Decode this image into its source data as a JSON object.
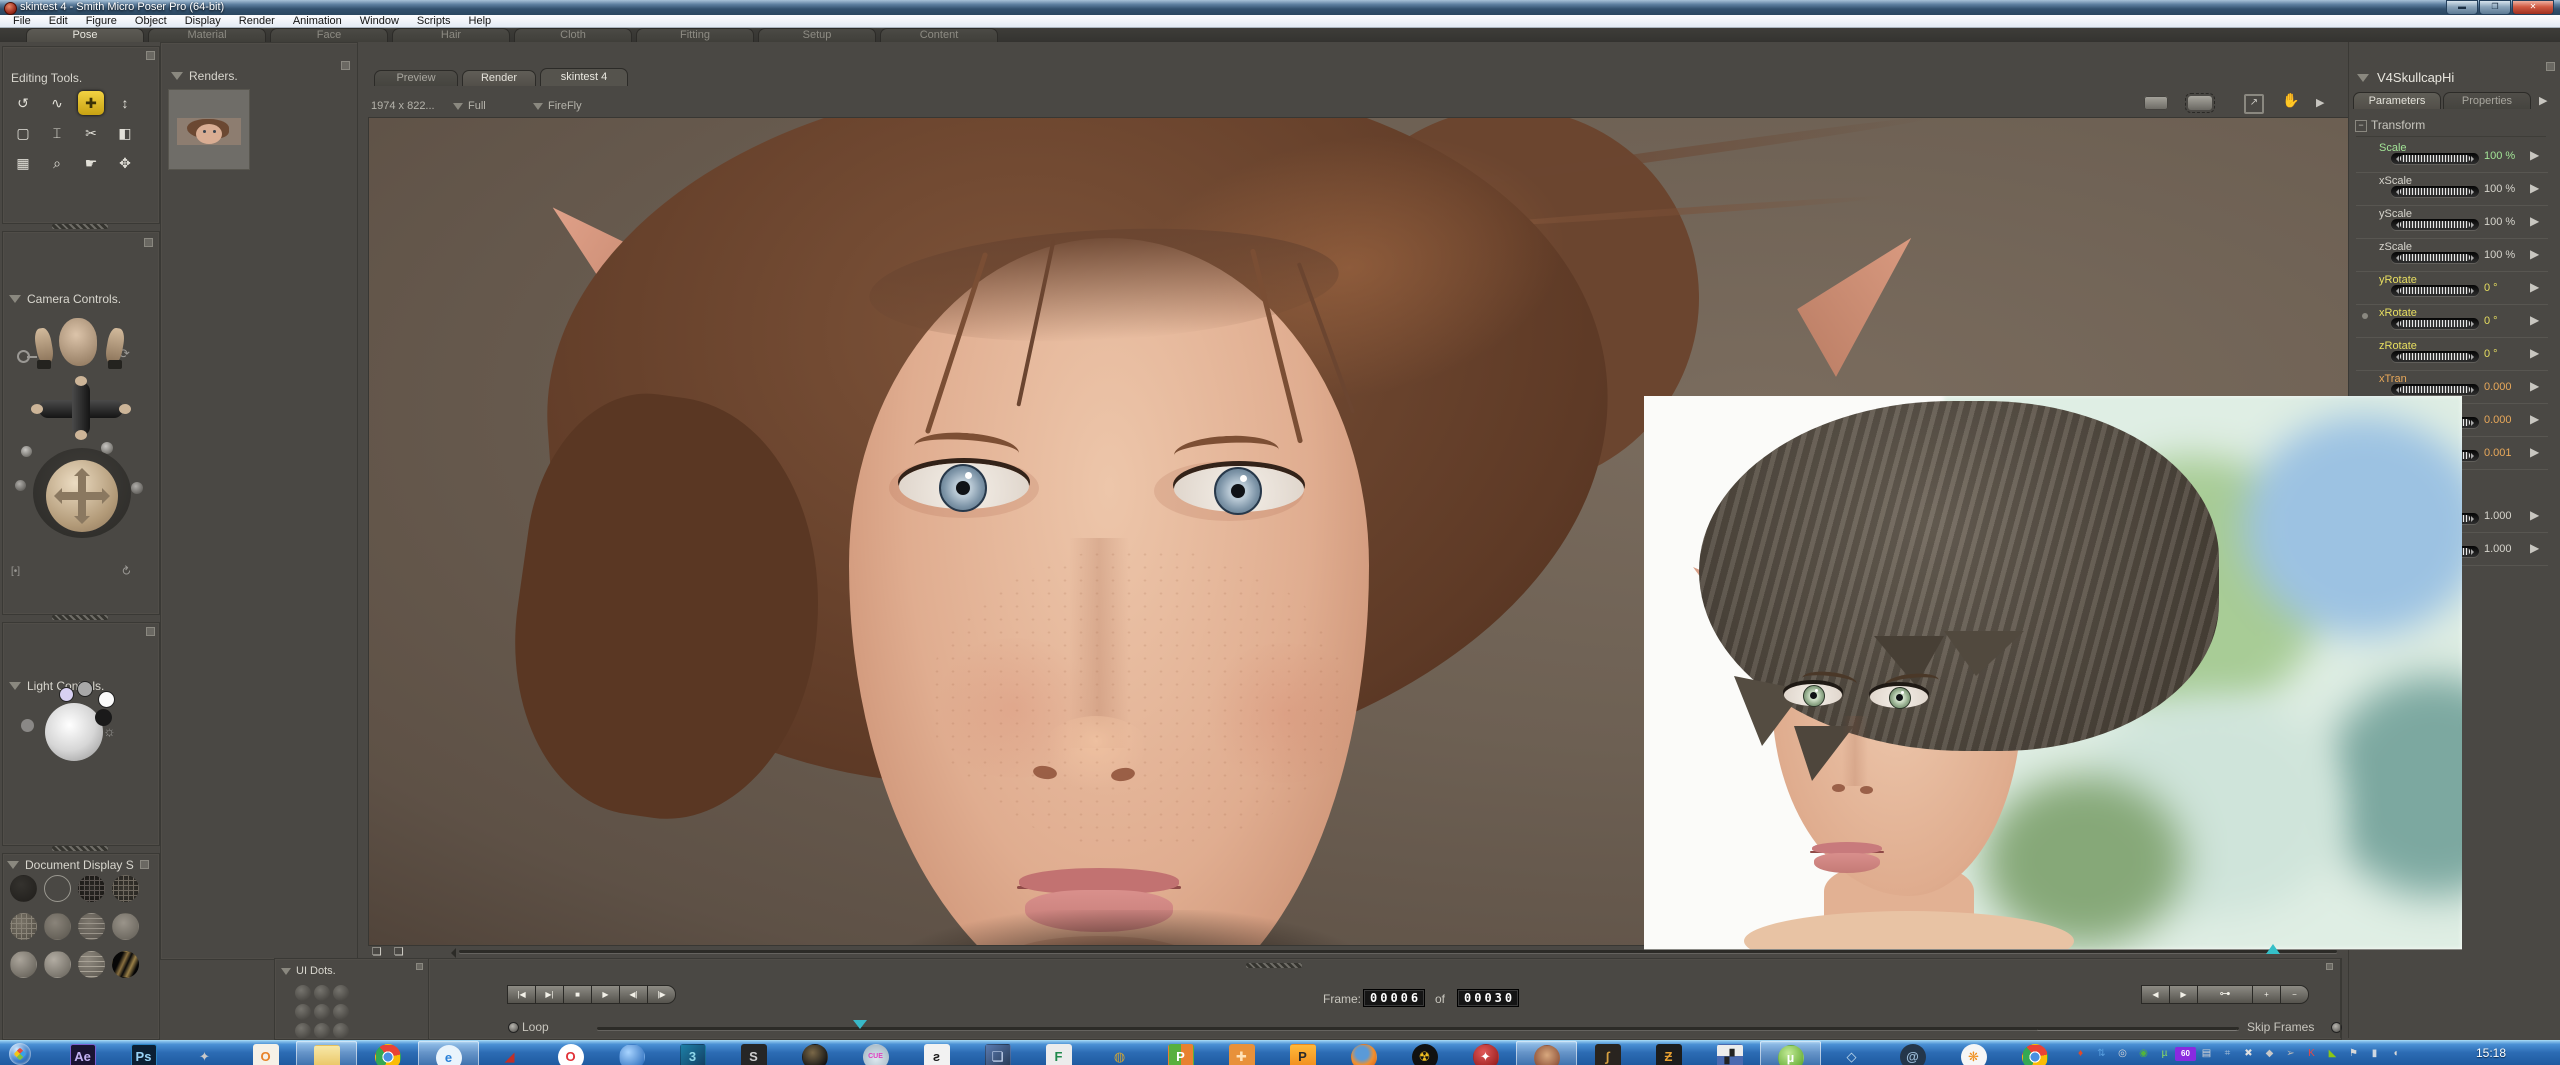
{
  "window": {
    "title": "skintest 4 - Smith Micro Poser Pro  (64-bit)"
  },
  "menu_bar": {
    "items": [
      {
        "label": "File",
        "n": "menu-file"
      },
      {
        "label": "Edit",
        "n": "menu-edit"
      },
      {
        "label": "Figure",
        "n": "menu-figure"
      },
      {
        "label": "Object",
        "n": "menu-object"
      },
      {
        "label": "Display",
        "n": "menu-display"
      },
      {
        "label": "Render",
        "n": "menu-render"
      },
      {
        "label": "Animation",
        "n": "menu-animation"
      },
      {
        "label": "Window",
        "n": "menu-window"
      },
      {
        "label": "Scripts",
        "n": "menu-scripts"
      },
      {
        "label": "Help",
        "n": "menu-help"
      }
    ]
  },
  "room_tabs": [
    {
      "label": "Pose",
      "cls": "active",
      "n": "tab-pose"
    },
    {
      "label": "Material",
      "n": "tab-material"
    },
    {
      "label": "Face",
      "n": "tab-face"
    },
    {
      "label": "Hair",
      "n": "tab-hair"
    },
    {
      "label": "Cloth",
      "n": "tab-cloth"
    },
    {
      "label": "Fitting",
      "n": "tab-fitting"
    },
    {
      "label": "Setup",
      "n": "tab-setup"
    },
    {
      "label": "Content",
      "n": "tab-content"
    }
  ],
  "panels": {
    "editing_tools": {
      "title": "Editing Tools.",
      "tools": [
        {
          "g": "↺",
          "n": "rotate-tool-icon"
        },
        {
          "g": "∿",
          "n": "twist-tool-icon"
        },
        {
          "g": "✚",
          "cls": "sel",
          "n": "translate-pull-tool-icon"
        },
        {
          "g": "↕",
          "n": "translate-inout-tool-icon"
        },
        {
          "g": "▢",
          "n": "scale-tool-icon"
        },
        {
          "g": "⌶",
          "n": "taper-tool-icon"
        },
        {
          "g": "✂",
          "n": "chain-break-tool-icon"
        },
        {
          "g": "◧",
          "n": "color-tool-icon"
        },
        {
          "g": "▦",
          "n": "grouping-tool-icon"
        },
        {
          "g": "⌕",
          "n": "view-magnifier-tool-icon"
        },
        {
          "g": "☛",
          "n": "morphing-tool-icon"
        },
        {
          "g": "✥",
          "n": "direct-manipulation-tool-icon"
        }
      ]
    },
    "camera_controls": {
      "title": "Camera Controls."
    },
    "light_controls": {
      "title": "Light Controls."
    },
    "document_display": {
      "title": "Document Display S",
      "styles": [
        {
          "bg": "radial-gradient(circle at 40% 35%, #34322e, #201e1b)",
          "n": "style-silhouette"
        },
        {
          "bg": "transparent",
          "bd": "#9a9890",
          "n": "style-outline"
        },
        {
          "bg": "repeating-linear-gradient(0deg,#5a5450 0 1px,transparent 1px 5px),repeating-linear-gradient(90deg,#5a5450 0 1px,transparent 1px 5px),radial-gradient(circle,#2a2825,#191714)",
          "n": "style-wireframe"
        },
        {
          "bg": "repeating-linear-gradient(0deg,#6e685e 0 1px,transparent 1px 5px),repeating-linear-gradient(90deg,#6e685e 0 1px,transparent 1px 5px),radial-gradient(circle,#3a3731,#24221e)",
          "n": "style-hidden-line"
        },
        {
          "bg": "repeating-linear-gradient(0deg,#8a8478 0 1px,transparent 1px 5px),repeating-linear-gradient(90deg,#8a8478 0 1px,transparent 1px 5px),radial-gradient(circle at 40% 35%,#7a7468,#4c4840)",
          "n": "style-lit-wireframe"
        },
        {
          "bg": "radial-gradient(circle at 40% 35%,#8a847a,#5a564e)",
          "n": "style-flat-shaded"
        },
        {
          "bg": "repeating-linear-gradient(0deg,#9a948a 0 1px,transparent 1px 5px),radial-gradient(circle at 40% 35%,#7e786e,#54504a)",
          "n": "style-flat-lined"
        },
        {
          "bg": "radial-gradient(circle at 42% 35%,#9a948a,#625e56)",
          "n": "style-cartoon"
        },
        {
          "bg": "radial-gradient(circle at 35% 30%,#aaa49a,#5e5a52)",
          "n": "style-cartoon-lined"
        },
        {
          "bg": "radial-gradient(circle at 35% 30%,#b2aca2,#66625a)",
          "n": "style-smooth-shaded"
        },
        {
          "bg": "repeating-linear-gradient(0deg,#a8a296 0 1px,transparent 1px 5px),radial-gradient(circle at 35% 30%,#8e887e,#5a564e)",
          "n": "style-smooth-lined"
        },
        {
          "bg": "linear-gradient(115deg,#070707 28%,#8a7040 42%,#0a0a0a 54%,#9a8048 68%,#060606 84%)",
          "n": "style-texture-shaded"
        }
      ]
    },
    "renders": {
      "title": "Renders."
    },
    "ui_dots": {
      "title": "UI Dots."
    }
  },
  "render_view": {
    "tabs": [
      {
        "label": "Preview",
        "n": "tab-preview"
      },
      {
        "label": "Render",
        "cls": "active",
        "n": "tab-render"
      },
      {
        "label": "skintest 4",
        "cls": "doc",
        "n": "tab-document-skintest4"
      }
    ],
    "info": {
      "size": "1974 x 822...",
      "zoom": "Full",
      "engine": "FireFly"
    }
  },
  "parameters": {
    "figure": "V4SkullcapHi",
    "tabs": [
      {
        "label": "Parameters",
        "cls": "active",
        "n": "tab-parameters"
      },
      {
        "label": "Properties",
        "n": "tab-properties"
      }
    ],
    "section": "Transform",
    "accent_colors": {
      "scale_green": "#a2e396",
      "neutral": "#d6d4cc",
      "rotate_yellow": "#e8df60",
      "translate_orange": "#e8a85a"
    },
    "dials": [
      {
        "label": "Scale",
        "value": "100 %",
        "c": "#a2e396"
      },
      {
        "label": "xScale",
        "value": "100 %",
        "c": "#d6d4cc"
      },
      {
        "label": "yScale",
        "value": "100 %",
        "c": "#d6d4cc"
      },
      {
        "label": "zScale",
        "value": "100 %",
        "c": "#d6d4cc"
      },
      {
        "label": "yRotate",
        "value": "0 °",
        "c": "#e8df60"
      },
      {
        "label": "xRotate",
        "value": "0 °",
        "c": "#e8df60",
        "dot": "1"
      },
      {
        "label": "zRotate",
        "value": "0 °",
        "c": "#e8df60"
      },
      {
        "label": "xTran",
        "value": "0.000",
        "c": "#e8a85a"
      },
      {
        "label": "",
        "value": "0.000",
        "c": "#e8a85a"
      },
      {
        "label": "",
        "value": "0.001",
        "c": "#e8a85a"
      }
    ],
    "lower_dials": [
      {
        "label": "",
        "value": "1.000",
        "c": "#d6d4cc"
      },
      {
        "label": "",
        "value": "1.000",
        "c": "#d6d4cc"
      }
    ]
  },
  "animation": {
    "transport": [
      {
        "g": "|◀",
        "n": "first-frame-button"
      },
      {
        "g": "▶|",
        "n": "last-frame-button"
      },
      {
        "g": "■",
        "n": "stop-button"
      },
      {
        "g": "▶",
        "n": "play-button"
      },
      {
        "g": "◀|",
        "n": "previous-frame-button"
      },
      {
        "g": "|▶",
        "n": "next-frame-button"
      }
    ],
    "key_transport": [
      {
        "g": "◀",
        "n": "previous-keyframe-button"
      },
      {
        "g": "▶",
        "n": "next-keyframe-button"
      },
      {
        "g": "⊶",
        "cls": "wide",
        "n": "edit-keyframes-button"
      },
      {
        "g": "+",
        "n": "add-keyframe-button"
      },
      {
        "g": "−",
        "n": "delete-keyframe-button"
      }
    ],
    "frame_label": "Frame:",
    "frame_current": "00006",
    "of_label": "of",
    "frame_total": "00030",
    "loop_label": "Loop",
    "skip_frames_label": "Skip Frames"
  },
  "taskbar": {
    "clock": "15:18",
    "pinned": [
      {
        "g": "Ae",
        "bg": "#1a1333",
        "fg": "#c3b2f2",
        "bd": "#7a5fd0",
        "n": "after-effects-icon"
      },
      {
        "g": "Ps",
        "bg": "#0b1f33",
        "fg": "#98d2f5",
        "bd": "#2d84c4",
        "n": "photoshop-icon"
      },
      {
        "g": "✦",
        "bg": "transparent",
        "fg": "#c9c9c9",
        "n": "grey-tool-icon"
      },
      {
        "g": "O",
        "bg": "#f6f1e7",
        "fg": "#e8832a",
        "n": "outlook-icon"
      },
      {
        "g": "",
        "bg": "linear-gradient(180deg,#f7e8a8,#e8c05a)",
        "fg": "#8a6a20",
        "hl": "1",
        "n": "explorer-folder-icon"
      },
      {
        "g": "",
        "bg": "radial-gradient(circle at 50% 50%,#4a90e2 0 26%,#ffffff 27% 33%,transparent 34%),conic-gradient(from -40deg,#ea4335 0 33%,#fbbc05 0 66%,#34a853 0 100%)",
        "cls": "round",
        "n": "chrome-icon"
      },
      {
        "g": "e",
        "bg": "#eaf4fc",
        "fg": "#2a80d8",
        "cls": "round",
        "hl": "1",
        "n": "internet-explorer-icon"
      },
      {
        "g": "◢",
        "bg": "transparent",
        "fg": "#c23028",
        "n": "red-utility-icon"
      },
      {
        "g": "O",
        "bg": "#ffffff",
        "fg": "#e13238",
        "cls": "round",
        "n": "opera-icon"
      },
      {
        "g": "",
        "bg": "radial-gradient(circle at 35% 30%,#a8d4ff,#1c60b4)",
        "cls": "round",
        "n": "blue-orb-icon"
      },
      {
        "g": "3",
        "bg": "linear-gradient(135deg,#1d7fa6,#123a5e)",
        "fg": "#8fd8ea",
        "n": "3ds-max-icon"
      },
      {
        "g": "S",
        "bg": "#262626",
        "fg": "#cfcfcf",
        "n": "dark-s-icon"
      },
      {
        "g": "",
        "bg": "radial-gradient(circle at 40% 32%,#7a6848,#151515 75%)",
        "cls": "round",
        "n": "dark-sphere-icon"
      },
      {
        "g": "CUE",
        "bg": "radial-gradient(circle at 50% 58%,#dce8ee,#9fb2c0)",
        "fg": "#e03ec0",
        "cls": "cue",
        "n": "cue-disc-icon"
      },
      {
        "g": "ƨ",
        "bg": "#f2f2f2",
        "fg": "#1a1a1a",
        "n": "runner-icon"
      },
      {
        "g": "❏",
        "bg": "linear-gradient(135deg,#5a7ab0,#233650)",
        "fg": "#d8e6ff",
        "n": "computer-search-icon"
      },
      {
        "g": "F",
        "bg": "#ececec",
        "fg": "#1f8a4c",
        "n": "fxp-icon"
      },
      {
        "g": "◍",
        "bg": "transparent",
        "fg": "#caa23a",
        "n": "padlock-icon"
      },
      {
        "g": "P",
        "bg": "linear-gradient(90deg,#57b03e 50%,#e8812f 50%)",
        "fg": "#ffffff",
        "n": "peazip-icon"
      },
      {
        "g": "✚",
        "bg": "#e8913a",
        "fg": "#ffe2b8",
        "n": "orange-puzzle-icon"
      },
      {
        "g": "P",
        "bg": "linear-gradient(180deg,#ffb83a,#f08a1a)",
        "fg": "#2a2a2a",
        "n": "poser-icon"
      },
      {
        "g": "",
        "bg": "radial-gradient(circle at 42% 35%,#5a9ad8 0 30%,#f09030 55%,#d85a10)",
        "cls": "round",
        "n": "firefox-icon"
      },
      {
        "g": "☢",
        "bg": "#111111",
        "fg": "#f2c020",
        "cls": "round",
        "n": "radiation-icon"
      },
      {
        "g": "✦",
        "bg": "radial-gradient(circle at 40% 30%,#e05858,#8a1212)",
        "fg": "#ffffff",
        "cls": "round",
        "n": "red-figure-icon"
      },
      {
        "g": "",
        "bg": "radial-gradient(circle at 50% 38%,#d8a87e,#7a3c28)",
        "cls": "round",
        "hl": "1",
        "n": "brain-icon"
      },
      {
        "g": "∫",
        "bg": "#29241f",
        "fg": "#d8a040",
        "n": "gold-curve-icon"
      },
      {
        "g": "Ƶ",
        "bg": "#1c1c1c",
        "fg": "#e8a030",
        "n": "zbrush-icon"
      },
      {
        "g": "▞",
        "bg": "linear-gradient(180deg,#ececec 45%,#4a6ab0 45%)",
        "fg": "#222222",
        "n": "film-clapper-icon"
      },
      {
        "g": "µ",
        "bg": "radial-gradient(circle at 40% 30%,#c2ea96,#4f9e1e)",
        "fg": "#ffffff",
        "cls": "round",
        "hl": "1",
        "n": "utorrent-icon"
      },
      {
        "g": "◇",
        "bg": "transparent",
        "fg": "#c2dcee",
        "n": "blue-prism-icon"
      },
      {
        "g": "@",
        "bg": "#24364a",
        "fg": "#9cbcd8",
        "cls": "round",
        "n": "spiral-icon"
      },
      {
        "g": "❋",
        "bg": "#f6f6f6",
        "fg": "#f09020",
        "cls": "round",
        "n": "gom-player-icon"
      },
      {
        "g": "",
        "bg": "radial-gradient(circle at 50% 50%,#4a90e2 0 26%,#ffffff 27% 33%,transparent 34%),conic-gradient(from -40deg,#ea4335 0 33%,#fbbc05 0 66%,#34a853 0 100%)",
        "cls": "round",
        "n": "chrome-icon-2"
      }
    ],
    "tray": [
      {
        "g": "♦",
        "c": "#e04a28",
        "n": "tray-flame-icon"
      },
      {
        "g": "⇅",
        "c": "#5aa0e0",
        "n": "tray-updown-icon"
      },
      {
        "g": "◎",
        "c": "#d8d8d8",
        "n": "tray-creative-cloud-icon"
      },
      {
        "g": "◉",
        "c": "#52b43c",
        "n": "tray-green-icon"
      },
      {
        "g": "µ",
        "c": "#8ee060",
        "n": "tray-utorrent-icon"
      },
      {
        "g": "60",
        "c": "#ffffff",
        "cls": "box",
        "n": "tray-60-badge"
      },
      {
        "g": "▤",
        "c": "#d8d8d8",
        "n": "tray-clipboard-icon"
      },
      {
        "g": "⌗",
        "c": "#a8c0d8",
        "n": "tray-display-icon"
      },
      {
        "g": "✖",
        "c": "#e0e0e0",
        "n": "tray-x-icon"
      },
      {
        "g": "◆",
        "c": "#c8c8c8",
        "n": "tray-diamond-icon"
      },
      {
        "g": "➢",
        "c": "#b8b8b8",
        "n": "tray-arrow-icon"
      },
      {
        "g": "K",
        "c": "#e84848",
        "n": "tray-kaspersky-icon"
      },
      {
        "g": "◣",
        "c": "#8ac814",
        "n": "tray-nvidia-icon"
      },
      {
        "g": "⚑",
        "c": "#d8d8d8",
        "n": "tray-flag-icon"
      },
      {
        "g": "▮",
        "c": "#cfd8e2",
        "n": "tray-network-icon"
      },
      {
        "g": "◖",
        "c": "#d8d8d8",
        "n": "tray-volume-icon"
      }
    ]
  }
}
